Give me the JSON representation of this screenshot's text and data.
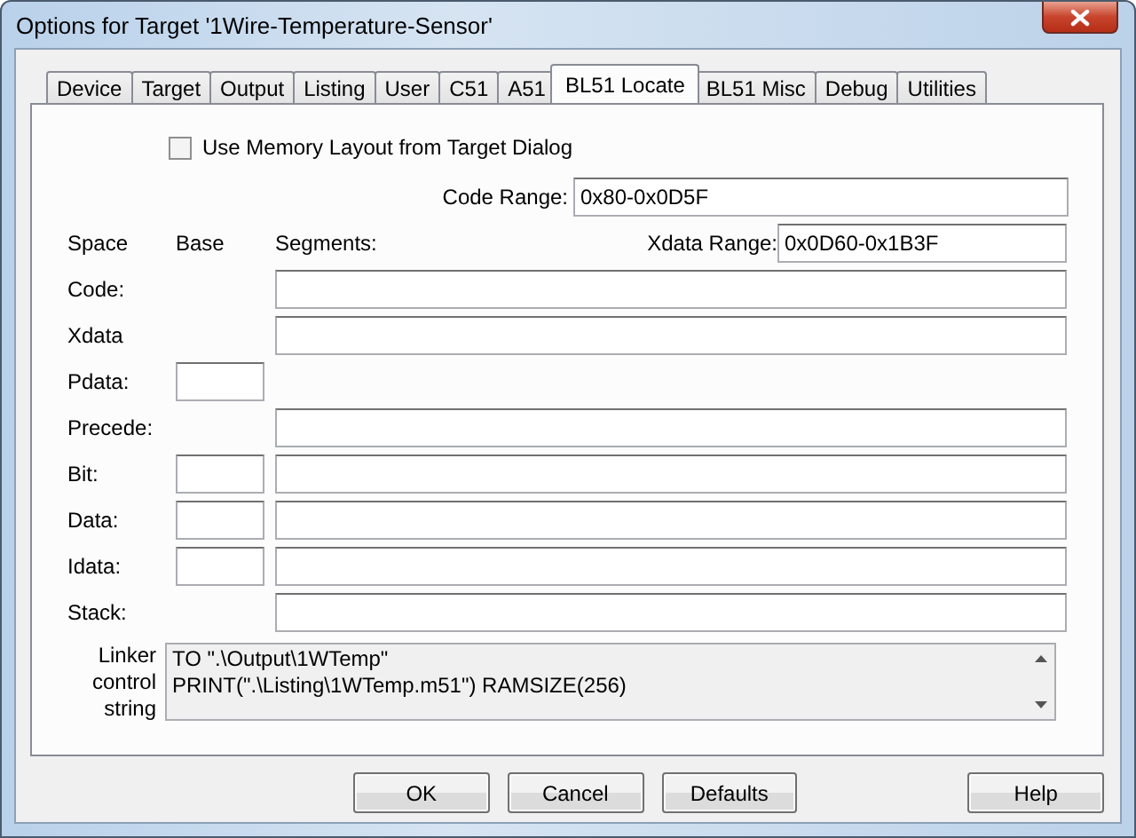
{
  "window": {
    "title": "Options for Target '1Wire-Temperature-Sensor'"
  },
  "tabs": [
    {
      "label": "Device",
      "selected": false
    },
    {
      "label": "Target",
      "selected": false
    },
    {
      "label": "Output",
      "selected": false
    },
    {
      "label": "Listing",
      "selected": false
    },
    {
      "label": "User",
      "selected": false
    },
    {
      "label": "C51",
      "selected": false
    },
    {
      "label": "A51",
      "selected": false
    },
    {
      "label": "BL51 Locate",
      "selected": true
    },
    {
      "label": "BL51 Misc",
      "selected": false
    },
    {
      "label": "Debug",
      "selected": false
    },
    {
      "label": "Utilities",
      "selected": false
    }
  ],
  "use_memory_layout": {
    "label": "Use Memory Layout from Target Dialog",
    "checked": false
  },
  "ranges": [
    {
      "label": "Code Range:",
      "value": "0x80-0x0D5F"
    },
    {
      "label": "Xdata Range:",
      "value": "0x0D60-0x1B3F"
    }
  ],
  "columns": [
    "Space",
    "Base",
    "Segments:"
  ],
  "rows": [
    {
      "label": "Code:",
      "has_base": false,
      "has_segments": true
    },
    {
      "label": "Xdata",
      "has_base": false,
      "has_segments": true
    },
    {
      "label": "Pdata:",
      "has_base": true,
      "has_segments": false
    },
    {
      "label": "Precede:",
      "has_base": false,
      "has_segments": true
    },
    {
      "label": "Bit:",
      "has_base": true,
      "has_segments": true
    },
    {
      "label": "Data:",
      "has_base": true,
      "has_segments": true
    },
    {
      "label": "Idata:",
      "has_base": true,
      "has_segments": true
    },
    {
      "label": "Stack:",
      "has_base": false,
      "has_segments": true
    }
  ],
  "linker_control": {
    "label": "Linker control string",
    "lines": [
      "TO \".\\Output\\1WTemp\"",
      "PRINT(\".\\Listing\\1WTemp.m51\") RAMSIZE(256)"
    ]
  },
  "buttons": [
    {
      "label": "OK"
    },
    {
      "label": "Cancel"
    },
    {
      "label": "Defaults"
    },
    {
      "label": "Help"
    }
  ]
}
